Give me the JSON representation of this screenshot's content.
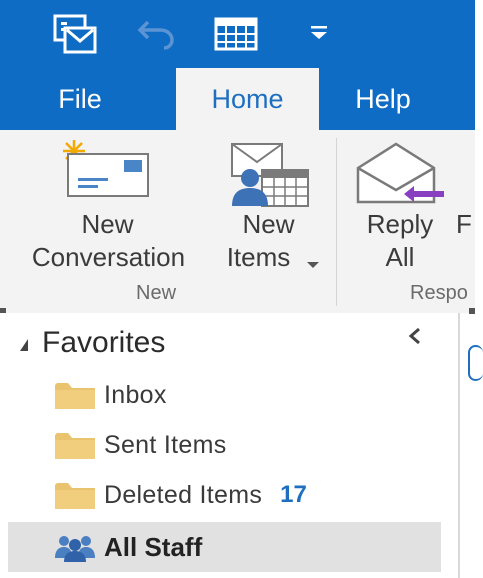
{
  "colors": {
    "accent": "#0f6cc4",
    "ribbon_bg": "#f3f3f3",
    "selected_bg": "#e1e1e1",
    "badge": "#1e6fc0",
    "reply_arrow": "#8a3fc0"
  },
  "quick_access": {
    "icons": [
      "send-receive-icon",
      "undo-icon",
      "calendar-grid-icon",
      "customize-dropdown-icon"
    ]
  },
  "tabs": [
    {
      "label": "File",
      "active": false
    },
    {
      "label": "Home",
      "active": true
    },
    {
      "label": "Help",
      "active": false
    }
  ],
  "ribbon": {
    "new_conversation": {
      "line1": "New",
      "line2": "Conversation",
      "icon": "new-email-icon"
    },
    "new_items": {
      "line1": "New",
      "line2": "Items",
      "icon": "new-items-icon"
    },
    "reply_all": {
      "line1": "Reply",
      "line2": "All",
      "icon": "reply-all-icon"
    },
    "cut_off_command": "F",
    "group_new_label": "New",
    "group_respond_label": "Respo"
  },
  "nav": {
    "favorites_label": "Favorites",
    "folders": [
      {
        "name": "Inbox",
        "count": ""
      },
      {
        "name": "Sent Items",
        "count": ""
      },
      {
        "name": "Deleted Items",
        "count": "17"
      }
    ],
    "group": {
      "name": "All Staff",
      "icon": "group-people-icon"
    }
  }
}
